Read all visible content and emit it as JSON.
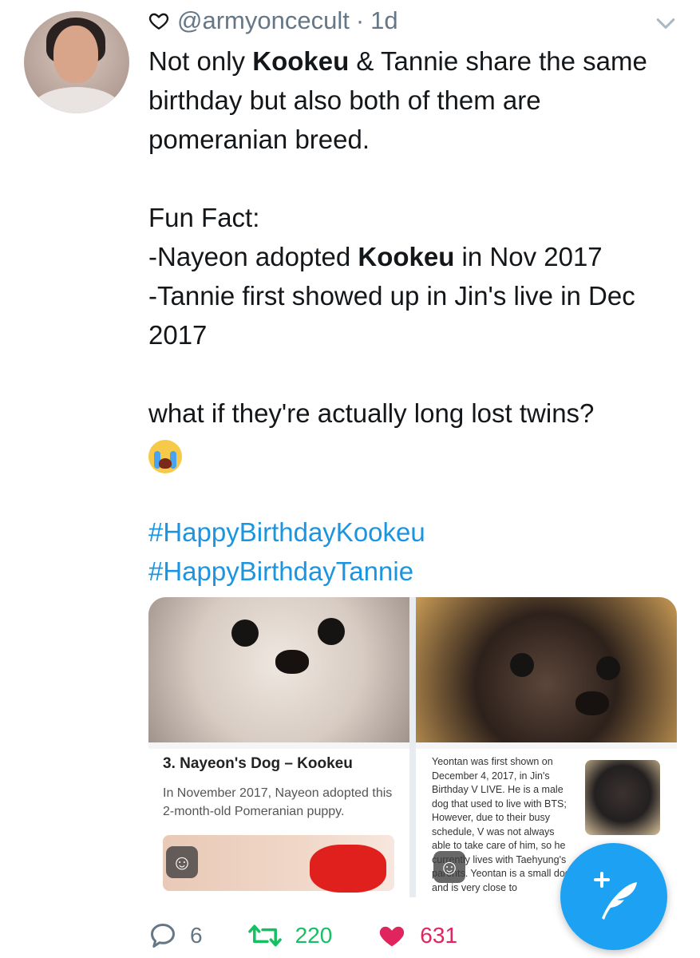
{
  "header": {
    "handle": "@armyoncecult",
    "separator": "·",
    "time": "1d"
  },
  "tweet": {
    "line1_pre": "Not only ",
    "line1_bold": "Kookeu",
    "line1_post": " & Tannie share the same birthday but also both of them are pomeranian breed.",
    "funfact_label": "Fun Fact:",
    "fact1_pre": "-Nayeon adopted ",
    "fact1_bold": "Kookeu",
    "fact1_post": " in Nov 2017",
    "fact2": "-Tannie first showed up in Jin's live in Dec 2017",
    "question": "what if they're actually long lost twins?",
    "hashtags": [
      "#HappyBirthdayKookeu",
      "#HappyBirthdayTannie"
    ]
  },
  "media": {
    "left_card": {
      "title": "3. Nayeon's Dog – Kookeu",
      "text": "In November 2017, Nayeon adopted this 2-month-old Pomeranian puppy."
    },
    "right_card": {
      "text": "Yeontan was first shown on December 4, 2017, in Jin's Birthday V LIVE. He is a male dog that used to live with BTS; However, due to their busy schedule, V was not always able to take care of him, so he currently lives with Taehyung's parents. Yeontan is a small dog and is very close to"
    },
    "sticker_icon": "smiley-sticker-icon"
  },
  "actions": {
    "replies": "6",
    "retweets": "220",
    "likes": "631"
  },
  "colors": {
    "link": "#1b95e0",
    "retweet": "#17bf63",
    "like": "#e0245e",
    "muted": "#657786",
    "fab": "#1da1f2"
  }
}
